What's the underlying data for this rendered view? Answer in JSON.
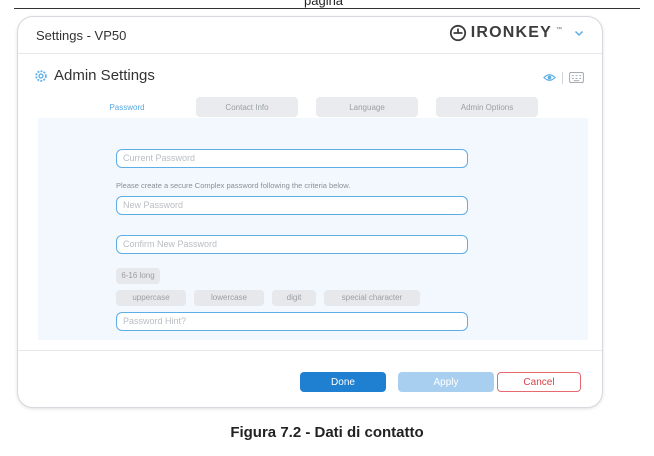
{
  "document": {
    "page_label": "pagina",
    "caption": "Figura 7.2 - Dati di contatto"
  },
  "window": {
    "title": "Settings - VP50",
    "brand": "IRONKEY",
    "brand_mark": "™"
  },
  "section": {
    "title": "Admin Settings"
  },
  "tabs": [
    {
      "label": "Password",
      "active": true
    },
    {
      "label": "Contact Info",
      "active": false
    },
    {
      "label": "Language",
      "active": false
    },
    {
      "label": "Admin Options",
      "active": false
    }
  ],
  "form": {
    "current_password_placeholder": "Current Password",
    "instructions": "Please create a secure Complex password following the criteria below.",
    "new_password_placeholder": "New Password",
    "confirm_password_placeholder": "Confirm New Password",
    "criteria_length": "6-16 long",
    "criteria": [
      "uppercase",
      "lowercase",
      "digit",
      "special character"
    ],
    "hint_placeholder": "Password Hint?"
  },
  "buttons": {
    "done": "Done",
    "apply": "Apply",
    "cancel": "Cancel"
  },
  "colors": {
    "accent": "#1f7fd1",
    "field_border": "#5eaee6",
    "cancel": "#d9434b"
  },
  "icons": {
    "brand_logo": "ironkey-logo-icon",
    "dropdown": "chevron-down-icon",
    "settings": "gear-icon",
    "visibility": "eye-icon",
    "keyboard": "keyboard-icon"
  }
}
